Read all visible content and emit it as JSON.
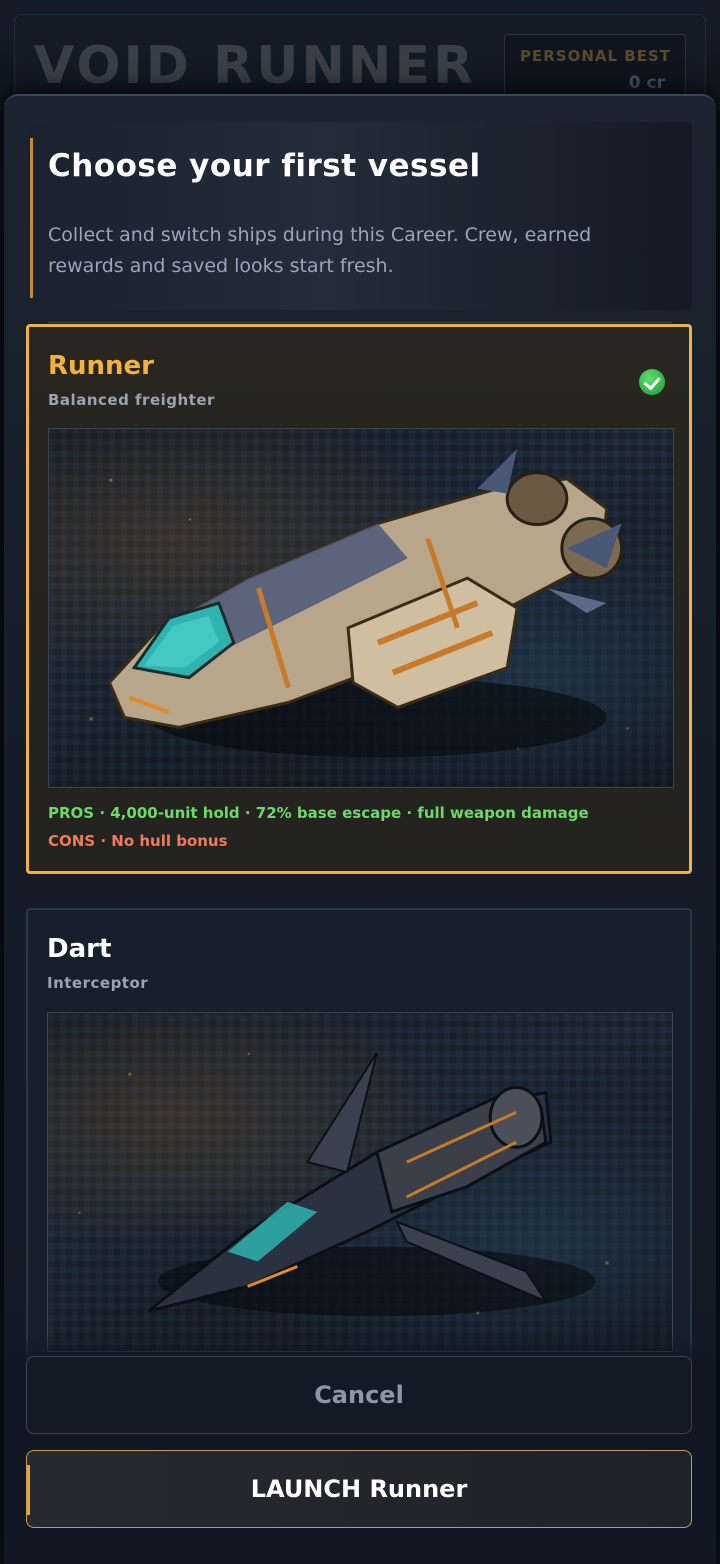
{
  "background": {
    "game_title": "VOID RUNNER",
    "personal_best_label": "PERSONAL BEST",
    "personal_best_value": "0 cr"
  },
  "modal": {
    "title": "Choose your first vessel",
    "description": "Collect and switch ships during this Career. Crew, earned rewards and saved looks start fresh."
  },
  "ships": [
    {
      "name": "Runner",
      "role": "Balanced freighter",
      "selected": true,
      "pros": "PROS · 4,000-unit hold · 72% base escape · full weapon damage",
      "cons": "CONS · No hull bonus"
    },
    {
      "name": "Dart",
      "role": "Interceptor",
      "selected": false
    }
  ],
  "buttons": {
    "cancel": "Cancel",
    "launch": "LAUNCH Runner"
  },
  "colors": {
    "accent": "#f2b23e",
    "pros": "#6ed86a",
    "cons": "#f07a5a",
    "selected_check": "#2fae45"
  }
}
